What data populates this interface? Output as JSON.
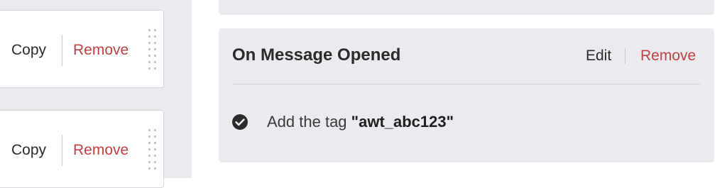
{
  "left_cards": [
    {
      "copy_label": "Copy",
      "remove_label": "Remove"
    },
    {
      "copy_label": "Copy",
      "remove_label": "Remove"
    }
  ],
  "event": {
    "title": "On Message Opened",
    "edit_label": "Edit",
    "remove_label": "Remove",
    "action": {
      "prefix": "Add the tag",
      "tag": "\"awt_abc123\""
    }
  },
  "icons": {
    "check": "check-circle-icon",
    "drag": "drag-handle-icon"
  },
  "colors": {
    "accent_remove": "#c43f3f",
    "panel_bg": "#ebebef",
    "text_dark": "#2b2b2b"
  }
}
